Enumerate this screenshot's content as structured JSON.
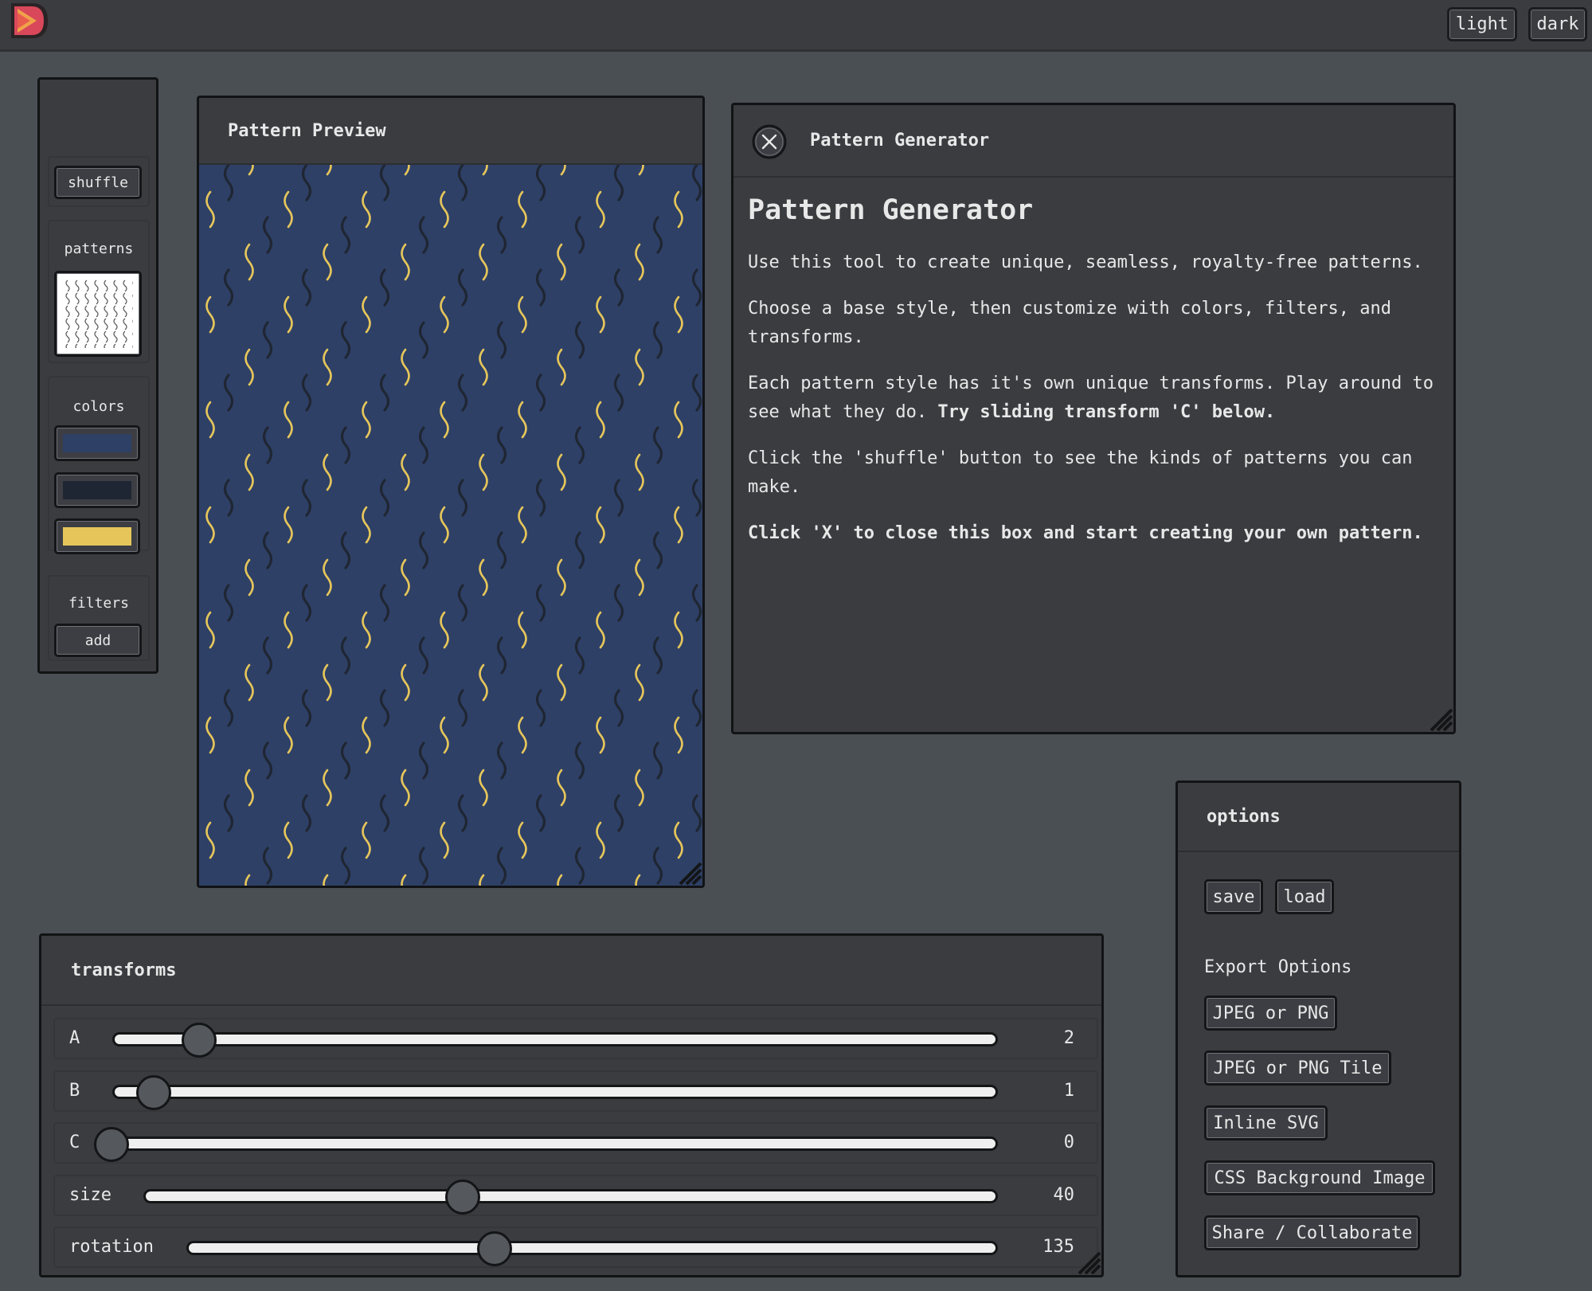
{
  "theme_buttons": {
    "light": "light",
    "dark": "dark"
  },
  "sidebar": {
    "shuffle": "shuffle",
    "patterns_label": "patterns",
    "colors_label": "colors",
    "colors": [
      "#2e4066",
      "#1f2633",
      "#e6c65a"
    ],
    "filters_label": "filters",
    "add": "add"
  },
  "preview": {
    "title": "Pattern Preview",
    "background": "#2e4066",
    "stroke_dark": "#1f2633",
    "stroke_light": "#e6c65a"
  },
  "dialog": {
    "header": "Pattern Generator",
    "heading": "Pattern Generator",
    "p1": "Use this tool to create unique, seamless, royalty-free patterns.",
    "p2": "Choose a base style, then customize with colors, filters, and transforms.",
    "p3_a": "Each pattern style has it's own unique transforms. Play around to see what they do.",
    "p3_b": "Try sliding transform 'C' below.",
    "p4": "Click the 'shuffle' button to see the kinds of patterns you can make.",
    "p5": "Click 'X' to close this box and start creating your own pattern."
  },
  "transforms": {
    "title": "transforms",
    "rows": [
      {
        "label": "A",
        "value": "2"
      },
      {
        "label": "B",
        "value": "1"
      },
      {
        "label": "C",
        "value": "0"
      },
      {
        "label": "size",
        "value": "40"
      },
      {
        "label": "rotation",
        "value": "135"
      }
    ]
  },
  "options": {
    "title": "options",
    "save": "save",
    "load": "load",
    "export_label": "Export Options",
    "exports": [
      "JPEG or PNG",
      "JPEG or PNG Tile",
      "Inline SVG",
      "CSS Background Image",
      "Share / Collaborate"
    ]
  }
}
